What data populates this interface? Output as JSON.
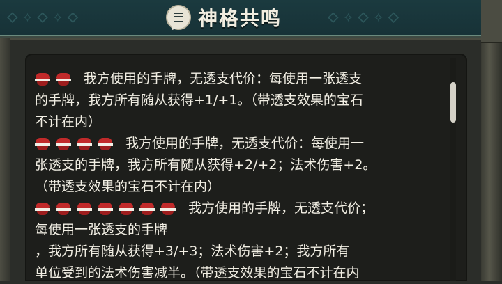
{
  "header": {
    "title": "神格共鸣"
  },
  "colors": {
    "gem_red": "#c12a2a",
    "text": "#f2efe4",
    "banner_bg": "#1b3a3f"
  },
  "tiers": [
    {
      "gem_count": 2,
      "lines": [
        "我方使用的手牌，无透支代价：每使用一张透支",
        "的手牌，我方所有随从获得+1/+1。（带透支效果的宝石",
        "不计在内）"
      ]
    },
    {
      "gem_count": 4,
      "lines": [
        "我方使用的手牌，无透支代价：每使用一",
        "张透支的手牌，我方所有随从获得+2/+2；法术伤害+2。",
        "（带透支效果的宝石不计在内）"
      ]
    },
    {
      "gem_count": 7,
      "lines": [
        "我方使用的手牌，无透支代价；",
        "每使用一张透支的手牌",
        "，我方所有随从获得+3/+3；法术伤害+2；我方所有",
        "单位受到的法术伤害减半。（带透支效果的宝石不计在内"
      ]
    }
  ]
}
